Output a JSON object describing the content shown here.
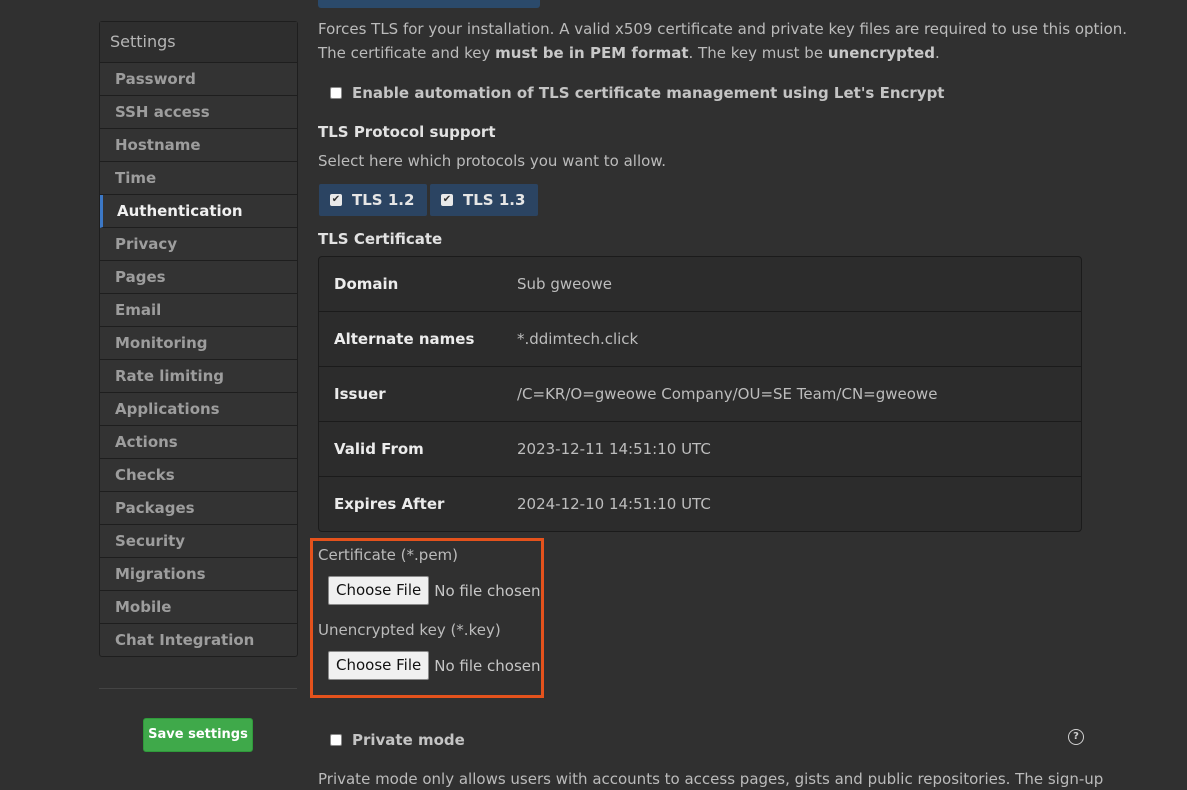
{
  "sidebar": {
    "heading": "Settings",
    "items": [
      {
        "label": "Password"
      },
      {
        "label": "SSH access"
      },
      {
        "label": "Hostname"
      },
      {
        "label": "Time"
      },
      {
        "label": "Authentication"
      },
      {
        "label": "Privacy"
      },
      {
        "label": "Pages"
      },
      {
        "label": "Email"
      },
      {
        "label": "Monitoring"
      },
      {
        "label": "Rate limiting"
      },
      {
        "label": "Applications"
      },
      {
        "label": "Actions"
      },
      {
        "label": "Checks"
      },
      {
        "label": "Packages"
      },
      {
        "label": "Security"
      },
      {
        "label": "Migrations"
      },
      {
        "label": "Mobile"
      },
      {
        "label": "Chat Integration"
      }
    ],
    "active_item": "Authentication",
    "save_label": "Save settings"
  },
  "tls": {
    "description_line1": "Forces TLS for your installation. A valid x509 certificate and private key files are required to use this option.",
    "description_line2_a": "The certificate and key ",
    "description_line2_b": "must be in PEM format",
    "description_line2_c": ". The key must be ",
    "description_line2_d": "unencrypted",
    "description_line2_e": ".",
    "letsencrypt_label": "Enable automation of TLS certificate management using Let's Encrypt",
    "protocol_title": "TLS Protocol support",
    "protocol_hint": "Select here which protocols you want to allow.",
    "protocols": [
      {
        "label": "TLS 1.2",
        "checked": true
      },
      {
        "label": "TLS 1.3",
        "checked": true
      }
    ],
    "certificate_title": "TLS Certificate",
    "certificate_rows": [
      {
        "key": "Domain",
        "value": "Sub gweowe"
      },
      {
        "key": "Alternate names",
        "value": "*.ddimtech.click"
      },
      {
        "key": "Issuer",
        "value": "/C=KR/O=gweowe Company/OU=SE Team/CN=gweowe"
      },
      {
        "key": "Valid From",
        "value": "2023-12-11 14:51:10 UTC"
      },
      {
        "key": "Expires After",
        "value": "2024-12-10 14:51:10 UTC"
      }
    ],
    "certificate_file_label": "Certificate (*.pem)",
    "key_file_label": "Unencrypted key (*.key)",
    "choose_file_label": "Choose File",
    "no_file_text": "No file chosen"
  },
  "privacy": {
    "private_mode_label": "Private mode",
    "private_mode_desc": "Private mode only allows users with accounts to access pages, gists and public repositories. The sign-up"
  },
  "colors": {
    "accent": "#3c78c6",
    "highlight": "#e4521c",
    "save_button": "#3fa94a"
  }
}
